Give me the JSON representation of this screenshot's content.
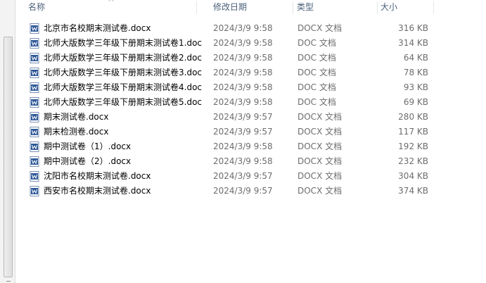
{
  "columns": {
    "name": "名称",
    "modified": "修改日期",
    "type": "类型",
    "size": "大小"
  },
  "colors": {
    "header_text": "#4c607a",
    "word_icon_blue": "#2b5797"
  },
  "files": [
    {
      "name": "北京市名校期末测试卷.docx",
      "modified": "2024/3/9 9:58",
      "type": "DOCX 文档",
      "size": "316 KB",
      "icon": "word-doc-icon"
    },
    {
      "name": "北师大版数学三年级下册期末测试卷1.doc",
      "modified": "2024/3/9 9:58",
      "type": "DOC 文档",
      "size": "314 KB",
      "icon": "word-doc-icon"
    },
    {
      "name": "北师大版数学三年级下册期末测试卷2.doc",
      "modified": "2024/3/9 9:58",
      "type": "DOC 文档",
      "size": "64 KB",
      "icon": "word-doc-icon"
    },
    {
      "name": "北师大版数学三年级下册期末测试卷3.doc",
      "modified": "2024/3/9 9:58",
      "type": "DOC 文档",
      "size": "78 KB",
      "icon": "word-doc-icon"
    },
    {
      "name": "北师大版数学三年级下册期末测试卷4.doc",
      "modified": "2024/3/9 9:58",
      "type": "DOC 文档",
      "size": "93 KB",
      "icon": "word-doc-icon"
    },
    {
      "name": "北师大版数学三年级下册期末测试卷5.doc",
      "modified": "2024/3/9 9:58",
      "type": "DOC 文档",
      "size": "69 KB",
      "icon": "word-doc-icon"
    },
    {
      "name": "期末测试卷.docx",
      "modified": "2024/3/9 9:57",
      "type": "DOCX 文档",
      "size": "280 KB",
      "icon": "word-doc-icon"
    },
    {
      "name": "期末检测卷.docx",
      "modified": "2024/3/9 9:57",
      "type": "DOCX 文档",
      "size": "117 KB",
      "icon": "word-doc-icon"
    },
    {
      "name": "期中测试卷（1）.docx",
      "modified": "2024/3/9 9:58",
      "type": "DOCX 文档",
      "size": "192 KB",
      "icon": "word-doc-icon"
    },
    {
      "name": "期中测试卷（2）.docx",
      "modified": "2024/3/9 9:58",
      "type": "DOCX 文档",
      "size": "232 KB",
      "icon": "word-doc-icon"
    },
    {
      "name": "沈阳市名校期末测试卷.docx",
      "modified": "2024/3/9 9:57",
      "type": "DOCX 文档",
      "size": "304 KB",
      "icon": "word-doc-icon"
    },
    {
      "name": "西安市名校期末测试卷.docx",
      "modified": "2024/3/9 9:57",
      "type": "DOCX 文档",
      "size": "374 KB",
      "icon": "word-doc-icon"
    }
  ]
}
